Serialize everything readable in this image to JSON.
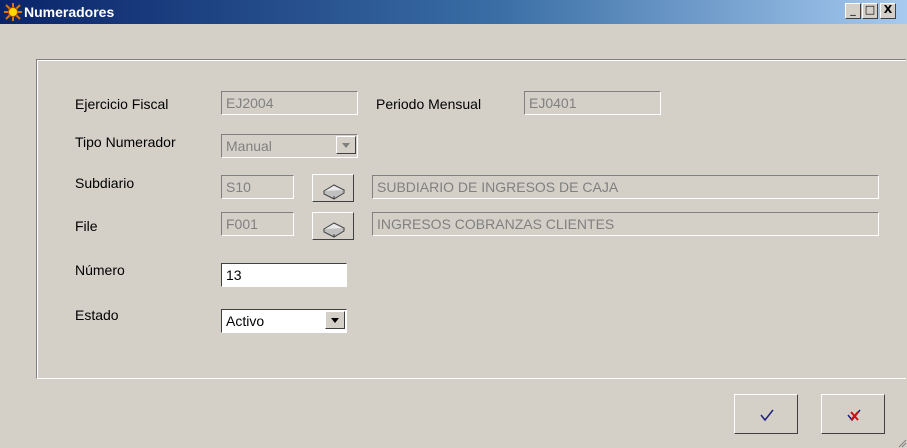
{
  "window": {
    "title": "Numeradores",
    "controls": {
      "minimize": "_",
      "maximize": "□",
      "close": "X"
    },
    "icon": "sun-app-icon"
  },
  "form": {
    "ejercicio_fiscal": {
      "label": "Ejercicio Fiscal",
      "value": "EJ2004"
    },
    "periodo_mensual": {
      "label": "Periodo Mensual",
      "value": "EJ0401"
    },
    "tipo_numerador": {
      "label": "Tipo Numerador",
      "value": "Manual"
    },
    "subdiario": {
      "label": "Subdiario",
      "code": "S10",
      "description": "SUBDIARIO DE INGRESOS DE CAJA"
    },
    "file": {
      "label": "File",
      "code": "F001",
      "description": "INGRESOS COBRANZAS CLIENTES"
    },
    "numero": {
      "label": "Número",
      "value": "13"
    },
    "estado": {
      "label": "Estado",
      "value": "Activo"
    }
  },
  "buttons": {
    "accept_icon": "checkmark-icon",
    "cancel_icon": "cancel-check-icon"
  },
  "colors": {
    "titlebar_start": "#0a246a",
    "titlebar_end": "#a6caf0",
    "face": "#d4d0c8",
    "disabled_text": "#808080"
  }
}
